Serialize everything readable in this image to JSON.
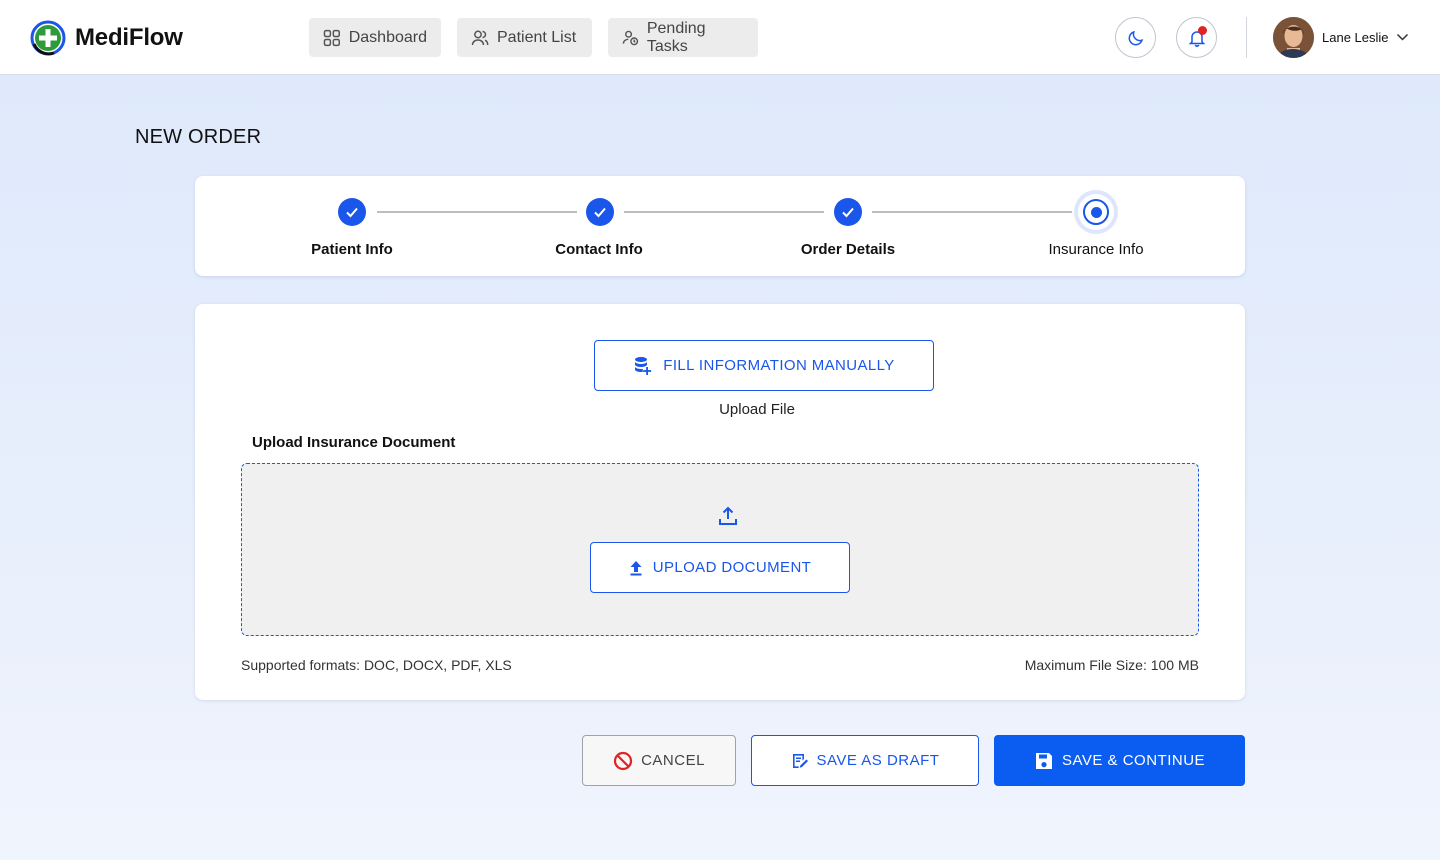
{
  "app": {
    "name": "MediFlow"
  },
  "nav": {
    "items": [
      {
        "label": "Dashboard",
        "icon": "grid-icon"
      },
      {
        "label": "Patient List",
        "icon": "users-icon"
      },
      {
        "label": "Pending Tasks",
        "icon": "user-clock-icon"
      }
    ]
  },
  "header": {
    "theme_icon": "moon-icon",
    "notification_icon": "bell-icon",
    "user": {
      "name": "Lane Leslie"
    }
  },
  "page": {
    "title": "NEW ORDER"
  },
  "stepper": {
    "steps": [
      {
        "label": "Patient Info",
        "status": "completed"
      },
      {
        "label": "Contact Info",
        "status": "completed"
      },
      {
        "label": "Order Details",
        "status": "completed"
      },
      {
        "label": "Insurance Info",
        "status": "active"
      }
    ]
  },
  "upload": {
    "fill_manual_label": "FILL INFORMATION MANUALLY",
    "upload_file_label": "Upload File",
    "section_label": "Upload Insurance Document",
    "upload_button_label": "UPLOAD DOCUMENT",
    "supported_formats": "Supported formats: DOC, DOCX, PDF, XLS",
    "max_size": "Maximum File Size: 100 MB"
  },
  "actions": {
    "cancel_label": "CANCEL",
    "draft_label": "SAVE AS DRAFT",
    "save_label": "SAVE & CONTINUE"
  },
  "colors": {
    "primary": "#1a56ea",
    "primary_button": "#0b5cf0",
    "logo_green": "#2e9b3a",
    "cancel_icon": "#e02424",
    "notification_dot": "#e02424"
  }
}
